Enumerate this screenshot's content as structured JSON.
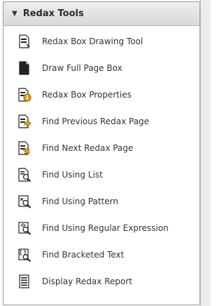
{
  "panel": {
    "title": "Redax Tools",
    "items": [
      {
        "label": "Redax Box Drawing Tool",
        "icon": "redax-box-drawing-icon"
      },
      {
        "label": "Draw Full Page Box",
        "icon": "full-page-box-icon"
      },
      {
        "label": "Redax Box Properties",
        "icon": "box-properties-icon"
      },
      {
        "label": "Find Previous Redax Page",
        "icon": "find-previous-page-icon"
      },
      {
        "label": "Find Next Redax Page",
        "icon": "find-next-page-icon"
      },
      {
        "label": "Find Using List",
        "icon": "find-using-list-icon"
      },
      {
        "label": "Find Using Pattern",
        "icon": "find-using-pattern-icon"
      },
      {
        "label": "Find Using Regular Expression",
        "icon": "find-regex-icon"
      },
      {
        "label": "Find Bracketed Text",
        "icon": "find-bracketed-text-icon"
      },
      {
        "label": "Display Redax Report",
        "icon": "report-icon"
      }
    ]
  },
  "colors": {
    "header_bg": "#e3e3e3",
    "text": "#333333",
    "accent_orange": "#e8a020",
    "icon_dark": "#222222"
  }
}
